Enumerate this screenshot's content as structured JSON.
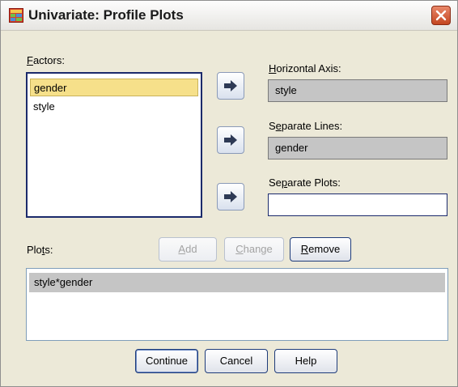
{
  "window": {
    "title": "Univariate: Profile Plots"
  },
  "factors": {
    "label_pre": "",
    "label_key": "F",
    "label_post": "actors:",
    "items": [
      "gender",
      "style"
    ],
    "selected_index": 0
  },
  "horizontal_axis": {
    "label_key": "H",
    "label_post": "orizontal Axis:",
    "value": "style"
  },
  "separate_lines": {
    "label_pre": "S",
    "label_key": "e",
    "label_post": "parate Lines:",
    "value": "gender"
  },
  "separate_plots": {
    "label_pre": "Se",
    "label_key": "p",
    "label_post": "arate Plots:",
    "value": ""
  },
  "plots": {
    "label_pre": "Plo",
    "label_key": "t",
    "label_post": "s:",
    "items": [
      "style*gender"
    ]
  },
  "buttons": {
    "add": {
      "key": "A",
      "rest": "dd"
    },
    "change": {
      "key": "C",
      "rest": "hange"
    },
    "remove": {
      "key": "R",
      "rest": "emove"
    },
    "continue": "Continue",
    "cancel": "Cancel",
    "help": "Help"
  },
  "icons": {
    "title": "grid-table-icon",
    "move": "move-right-arrow-icon",
    "close": "close-x-icon"
  },
  "colors": {
    "selected_factor": "#f6e08a",
    "disabled_field": "#c5c5c5",
    "close_button": "#c44520"
  }
}
